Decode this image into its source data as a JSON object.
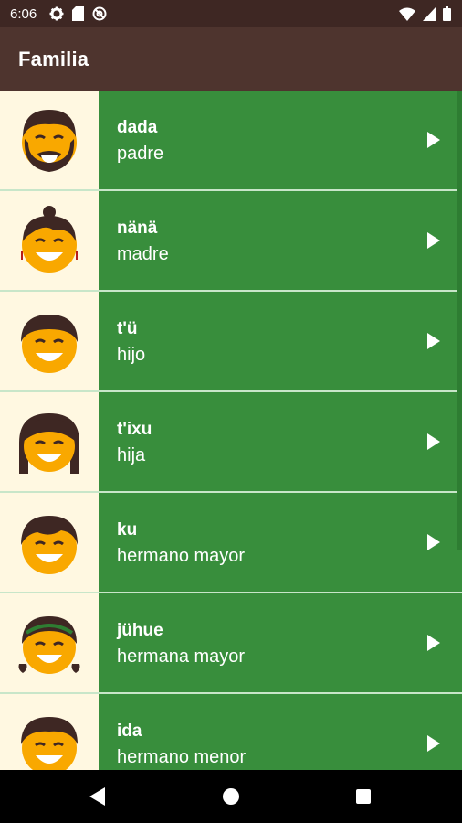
{
  "status_bar": {
    "time": "6:06",
    "icons_left": [
      "gear-icon",
      "sd-card-icon",
      "at-icon"
    ],
    "icons_right": [
      "wifi-icon",
      "signal-icon",
      "battery-icon"
    ]
  },
  "app_bar": {
    "title": "Familia"
  },
  "colors": {
    "app_bar": "#4e342e",
    "status_bar": "#3e2723",
    "row_green": "#388e3c",
    "avatar_bg": "#fff8e1",
    "face": "#f9a800",
    "hair": "#3e2723"
  },
  "items": [
    {
      "native": "dada",
      "spanish": "padre",
      "avatar": "father-avatar-icon"
    },
    {
      "native": "nänä",
      "spanish": "madre",
      "avatar": "mother-avatar-icon"
    },
    {
      "native": "t'ü",
      "spanish": "hijo",
      "avatar": "son-avatar-icon"
    },
    {
      "native": "t'ixu",
      "spanish": "hija",
      "avatar": "daughter-avatar-icon"
    },
    {
      "native": "ku",
      "spanish": "hermano mayor",
      "avatar": "older-brother-avatar-icon"
    },
    {
      "native": "jühue",
      "spanish": "hermana mayor",
      "avatar": "older-sister-avatar-icon"
    },
    {
      "native": "ida",
      "spanish": "hermano menor",
      "avatar": "younger-brother-avatar-icon"
    }
  ],
  "nav_bar": {
    "icons": [
      "back-icon",
      "home-icon",
      "recents-icon"
    ]
  }
}
